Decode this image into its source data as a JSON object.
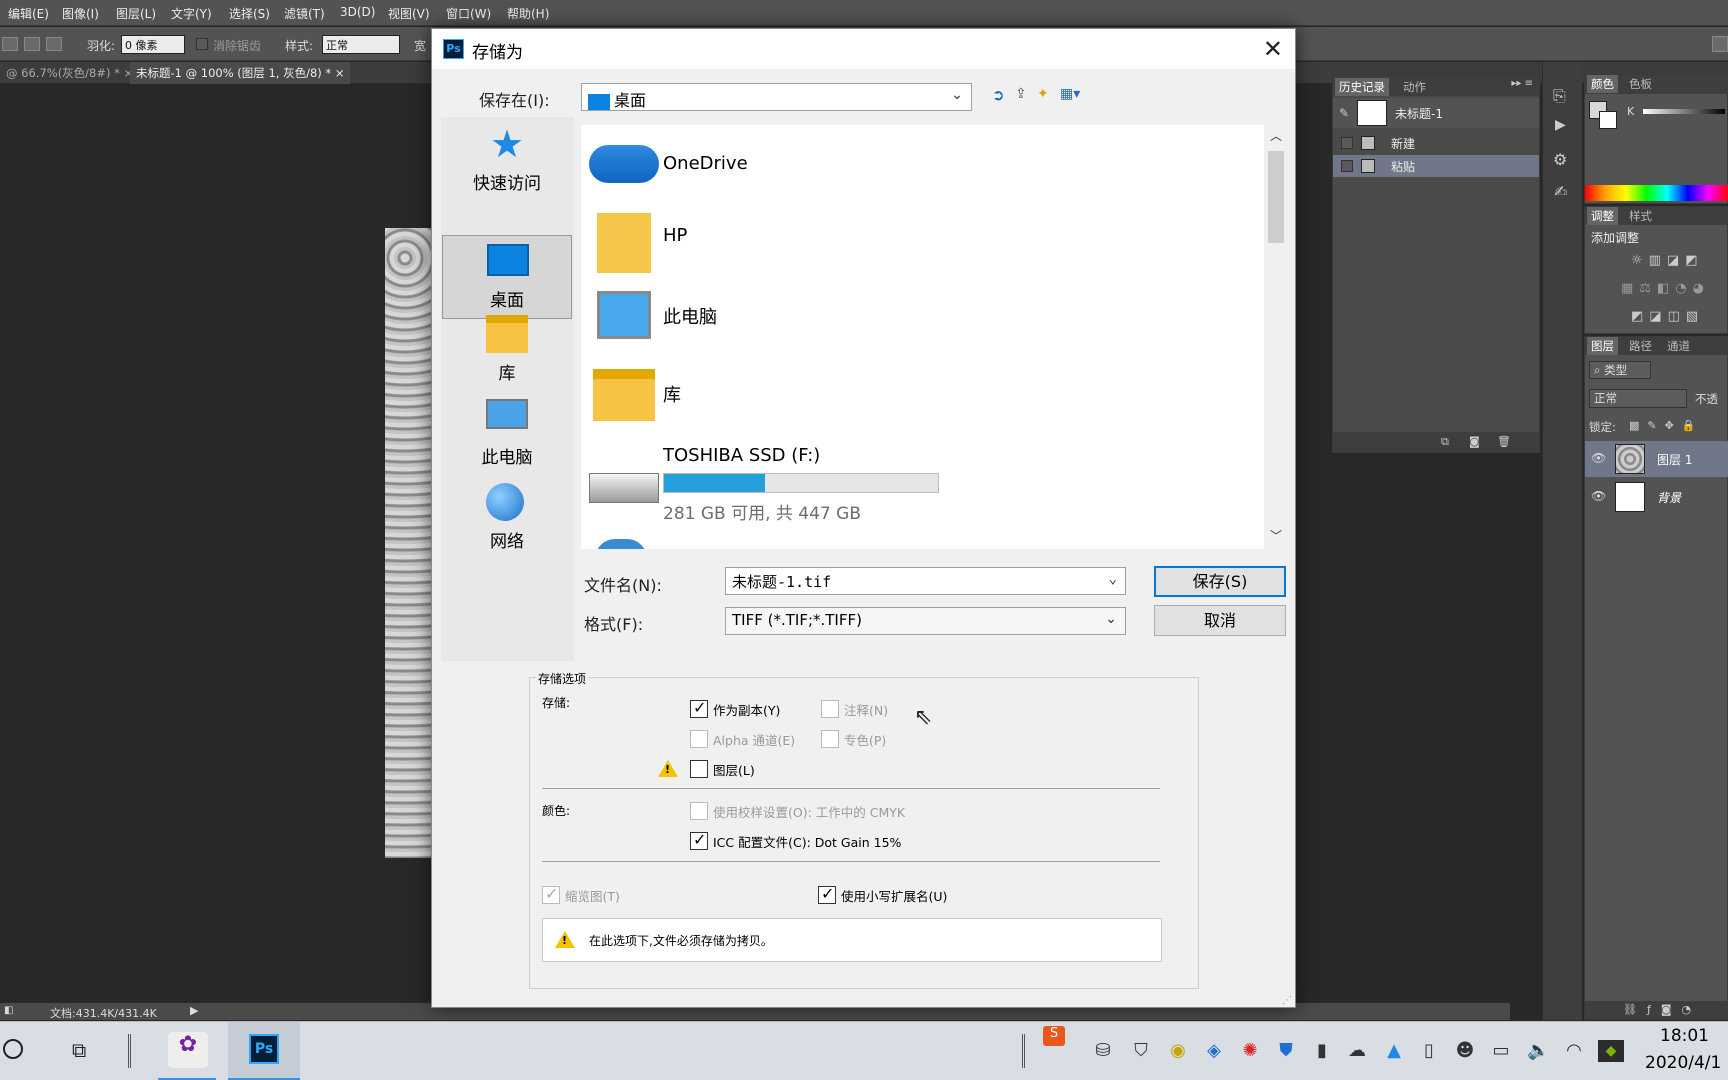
{
  "menubar": {
    "items": [
      "编辑(E)",
      "图像(I)",
      "图层(L)",
      "文字(Y)",
      "选择(S)",
      "滤镜(T)",
      "3D(D)",
      "视图(V)",
      "窗口(W)",
      "帮助(H)"
    ]
  },
  "optionsbar": {
    "feather_label": "羽化:",
    "feather_value": "0 像素",
    "antialias_label": "消除锯齿",
    "style_label": "样式:",
    "style_value": "正常",
    "width_label": "宽"
  },
  "doc_tabs": [
    {
      "label": "@ 66.7%(灰色/8#) *"
    },
    {
      "label": "未标题-1 @ 100% (图层 1, 灰色/8) *"
    }
  ],
  "statusbar": {
    "doc_info": "文档:431.4K/431.4K"
  },
  "history_panel": {
    "tabs": [
      "历史记录",
      "动作"
    ],
    "snapshot": "未标题-1",
    "items": [
      {
        "label": "新建",
        "selected": false
      },
      {
        "label": "粘贴",
        "selected": true
      }
    ]
  },
  "color_panel": {
    "tabs": [
      "颜色",
      "色板"
    ],
    "channel_label": "K"
  },
  "adjustments_panel": {
    "tabs": [
      "调整",
      "样式"
    ],
    "title": "添加调整"
  },
  "layers_panel": {
    "tabs": [
      "图层",
      "路径",
      "通道"
    ],
    "filter_label": "类型",
    "blend_mode": "正常",
    "opacity_label": "不透",
    "lock_label": "锁定:",
    "layers": [
      {
        "name": "图层 1",
        "selected": true
      },
      {
        "name": "背景",
        "selected": false
      }
    ]
  },
  "dialog": {
    "title": "存储为",
    "save_in_label": "保存在(I):",
    "save_in_value": "桌面",
    "places": [
      {
        "label": "快速访问",
        "icon": "star-icon"
      },
      {
        "label": "桌面",
        "icon": "desktop-icon",
        "selected": true
      },
      {
        "label": "库",
        "icon": "library-icon"
      },
      {
        "label": "此电脑",
        "icon": "computer-icon"
      },
      {
        "label": "网络",
        "icon": "network-icon"
      }
    ],
    "files": [
      {
        "name": "OneDrive",
        "icon": "onedrive-icon"
      },
      {
        "name": "HP",
        "icon": "user-folder-icon"
      },
      {
        "name": "此电脑",
        "icon": "computer-icon"
      },
      {
        "name": "库",
        "icon": "library-icon"
      },
      {
        "name": "TOSHIBA SSD (F:)",
        "icon": "drive-icon",
        "usage_fraction": 0.37,
        "detail": "281 GB 可用, 共 447 GB"
      }
    ],
    "filename_label": "文件名(N):",
    "filename_value": "未标题-1.tif",
    "format_label": "格式(F):",
    "format_value": "TIFF (*.TIF;*.TIFF)",
    "save_button": "保存(S)",
    "cancel_button": "取消",
    "options": {
      "group_title": "存储选项",
      "save_label": "存储:",
      "as_copy": {
        "label": "作为副本(Y)",
        "checked": true,
        "enabled": true
      },
      "notes": {
        "label": "注释(N)",
        "checked": false,
        "enabled": false
      },
      "alpha": {
        "label": "Alpha 通道(E)",
        "checked": false,
        "enabled": false
      },
      "spot": {
        "label": "专色(P)",
        "checked": false,
        "enabled": false
      },
      "layers": {
        "label": "图层(L)",
        "checked": false,
        "enabled": true
      },
      "color_label": "颜色:",
      "proof": {
        "label": "使用校样设置(O): 工作中的 CMYK",
        "checked": false,
        "enabled": false
      },
      "icc": {
        "label": "ICC 配置文件(C): Dot Gain 15%",
        "checked": true,
        "enabled": true
      },
      "thumbnail": {
        "label": "缩览图(T)",
        "checked": true,
        "enabled": false
      },
      "lowercase": {
        "label": "使用小写扩展名(U)",
        "checked": true,
        "enabled": true
      },
      "warning": "在此选项下,文件必须存储为拷贝。"
    }
  },
  "taskbar": {
    "time": "18:01",
    "date": "2020/4/1"
  },
  "colors": {
    "ps_gray": "#535353",
    "dialog_bg": "#f0f0f0",
    "accent": "#0078d7",
    "drive_bar": "#26a0da"
  }
}
